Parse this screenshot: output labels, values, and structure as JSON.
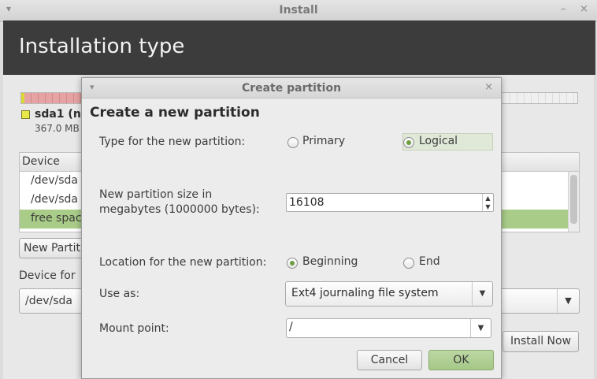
{
  "window": {
    "title": "Install",
    "menu_glyph": "▾",
    "minimize_glyph": "–",
    "close_glyph": "×"
  },
  "banner": {
    "title": "Installation type"
  },
  "partition_legend": {
    "name": "sda1 (n",
    "size": "367.0 MB"
  },
  "device_table": {
    "header": "Device",
    "rows": [
      {
        "label": "/dev/sda",
        "selected": false
      },
      {
        "label": "/dev/sda",
        "selected": false
      },
      {
        "label": "free spac",
        "selected": true
      }
    ]
  },
  "main_buttons": {
    "new_partition": "New Partiti",
    "install_now": "Install Now"
  },
  "bootloader": {
    "label": "Device for",
    "value": "/dev/sda"
  },
  "dialog": {
    "title": "Create partition",
    "menu_glyph": "▾",
    "close_glyph": "×",
    "heading": "Create a new partition",
    "type_label": "Type for the new partition:",
    "type_options": {
      "primary": "Primary",
      "logical": "Logical",
      "selected": "logical"
    },
    "size_label_line1": "New partition size in",
    "size_label_line2": "megabytes (1000000 bytes):",
    "size_value": "16108",
    "location_label": "Location for the new partition:",
    "location_options": {
      "beginning": "Beginning",
      "end": "End",
      "selected": "beginning"
    },
    "use_as_label": "Use as:",
    "use_as_value": "Ext4 journaling file system",
    "mount_label": "Mount point:",
    "mount_value": "/",
    "cancel_label": "Cancel",
    "ok_label": "OK"
  },
  "icons": {
    "dropdown_arrow": "▼",
    "spin_up": "▲",
    "spin_down": "▼"
  },
  "colors": {
    "banner_bg": "#3c3c3c",
    "selection_green": "#a9cc88",
    "partition_red": "#e7a3a3",
    "partition_yellow": "#e8e84a"
  }
}
